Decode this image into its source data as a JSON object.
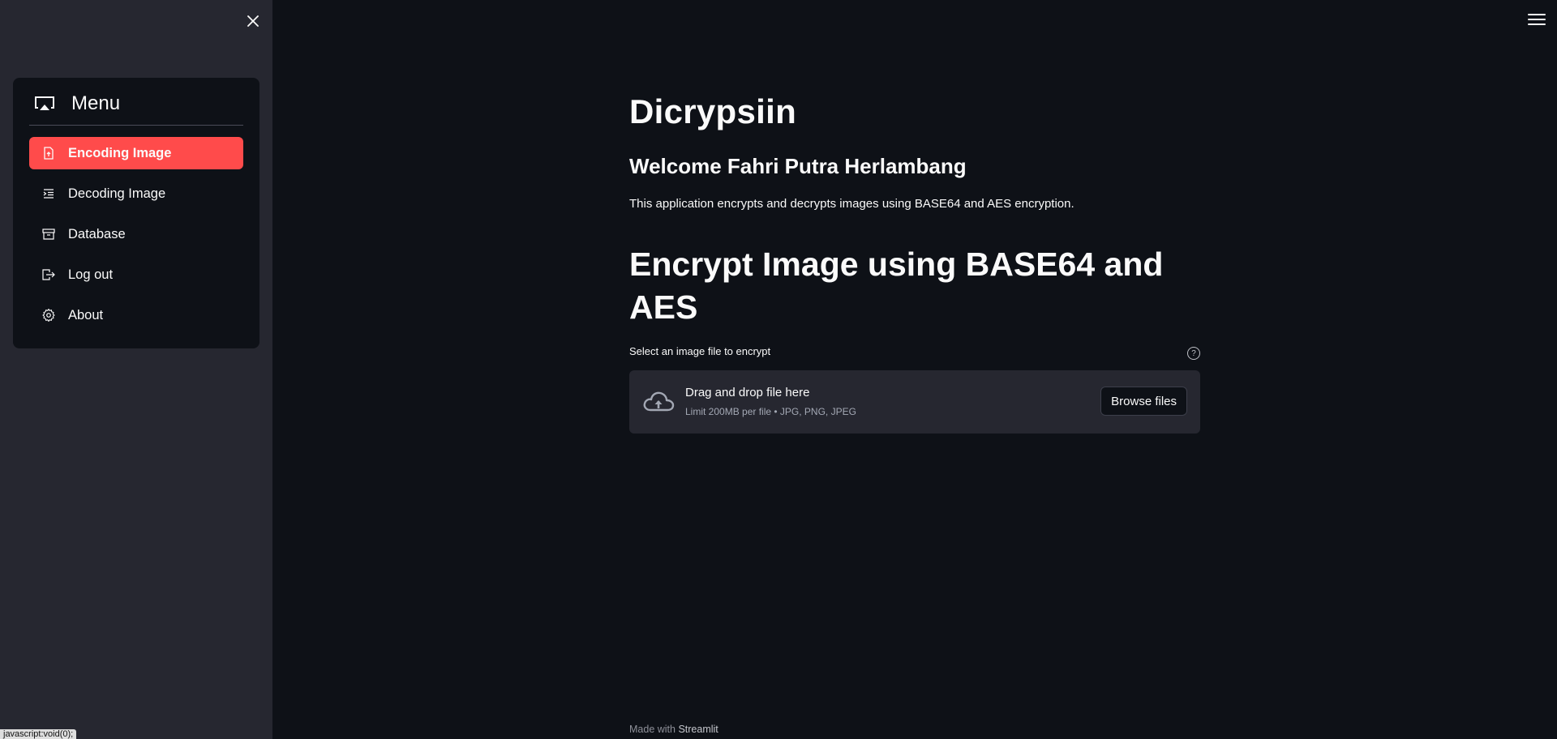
{
  "sidebar": {
    "menu_title": "Menu",
    "items": [
      {
        "label": "Encoding Image",
        "icon": "file-upload-icon",
        "active": true
      },
      {
        "label": "Decoding Image",
        "icon": "text-indent-icon",
        "active": false
      },
      {
        "label": "Database",
        "icon": "archive-icon",
        "active": false
      },
      {
        "label": "Log out",
        "icon": "logout-icon",
        "active": false
      },
      {
        "label": "About",
        "icon": "gear-icon",
        "active": false
      }
    ]
  },
  "main": {
    "title": "Dicrypsiin",
    "welcome": "Welcome Fahri Putra Herlambang",
    "description": "This application encrypts and decrypts images using BASE64 and AES encryption.",
    "section_title": "Encrypt Image using BASE64 and AES",
    "uploader": {
      "label": "Select an image file to encrypt",
      "help_symbol": "?",
      "drop_text": "Drag and drop file here",
      "limit_text": "Limit 200MB per file • JPG, PNG, JPEG",
      "browse_label": "Browse files"
    }
  },
  "footer": {
    "prefix": "Made with ",
    "link": "Streamlit"
  },
  "status_bar": {
    "url": "javascript:void(0);"
  },
  "colors": {
    "background": "#0e1117",
    "sidebar": "#262730",
    "accent": "#ff4b4b",
    "text": "#fafafa"
  }
}
